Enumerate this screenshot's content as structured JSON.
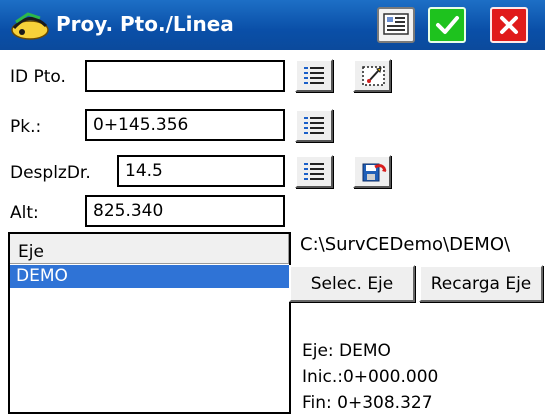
{
  "window": {
    "title": "Proy. Pto./Linea"
  },
  "icons": {
    "app": "survey-app-icon",
    "keypad": "keypad-icon",
    "ok": "checkmark-icon",
    "close": "close-x-icon",
    "list": "list-icon",
    "map_pick": "map-pick-icon",
    "save": "save-disk-icon"
  },
  "form": {
    "id_label": "ID Pto.",
    "id_value": "",
    "pk_label": "Pk.:",
    "pk_value": "0+145.356",
    "offset_label": "DesplzDr.",
    "offset_value": "14.5",
    "alt_label": "Alt:",
    "alt_value": "825.340"
  },
  "list": {
    "header": "Eje",
    "items": [
      "DEMO"
    ]
  },
  "panel": {
    "path": "C:\\SurvCEDemo\\DEMO\\",
    "select_button": "Selec. Eje",
    "reload_button": "Recarga Eje",
    "axis_line": "Eje:  DEMO",
    "start_line": "Inic.:0+000.000",
    "end_line": "Fin:  0+308.327"
  },
  "colors": {
    "titlebar": "#0b4fa8",
    "ok": "#1ec21e",
    "close": "#e01b1b",
    "selection": "#2f73d6"
  }
}
